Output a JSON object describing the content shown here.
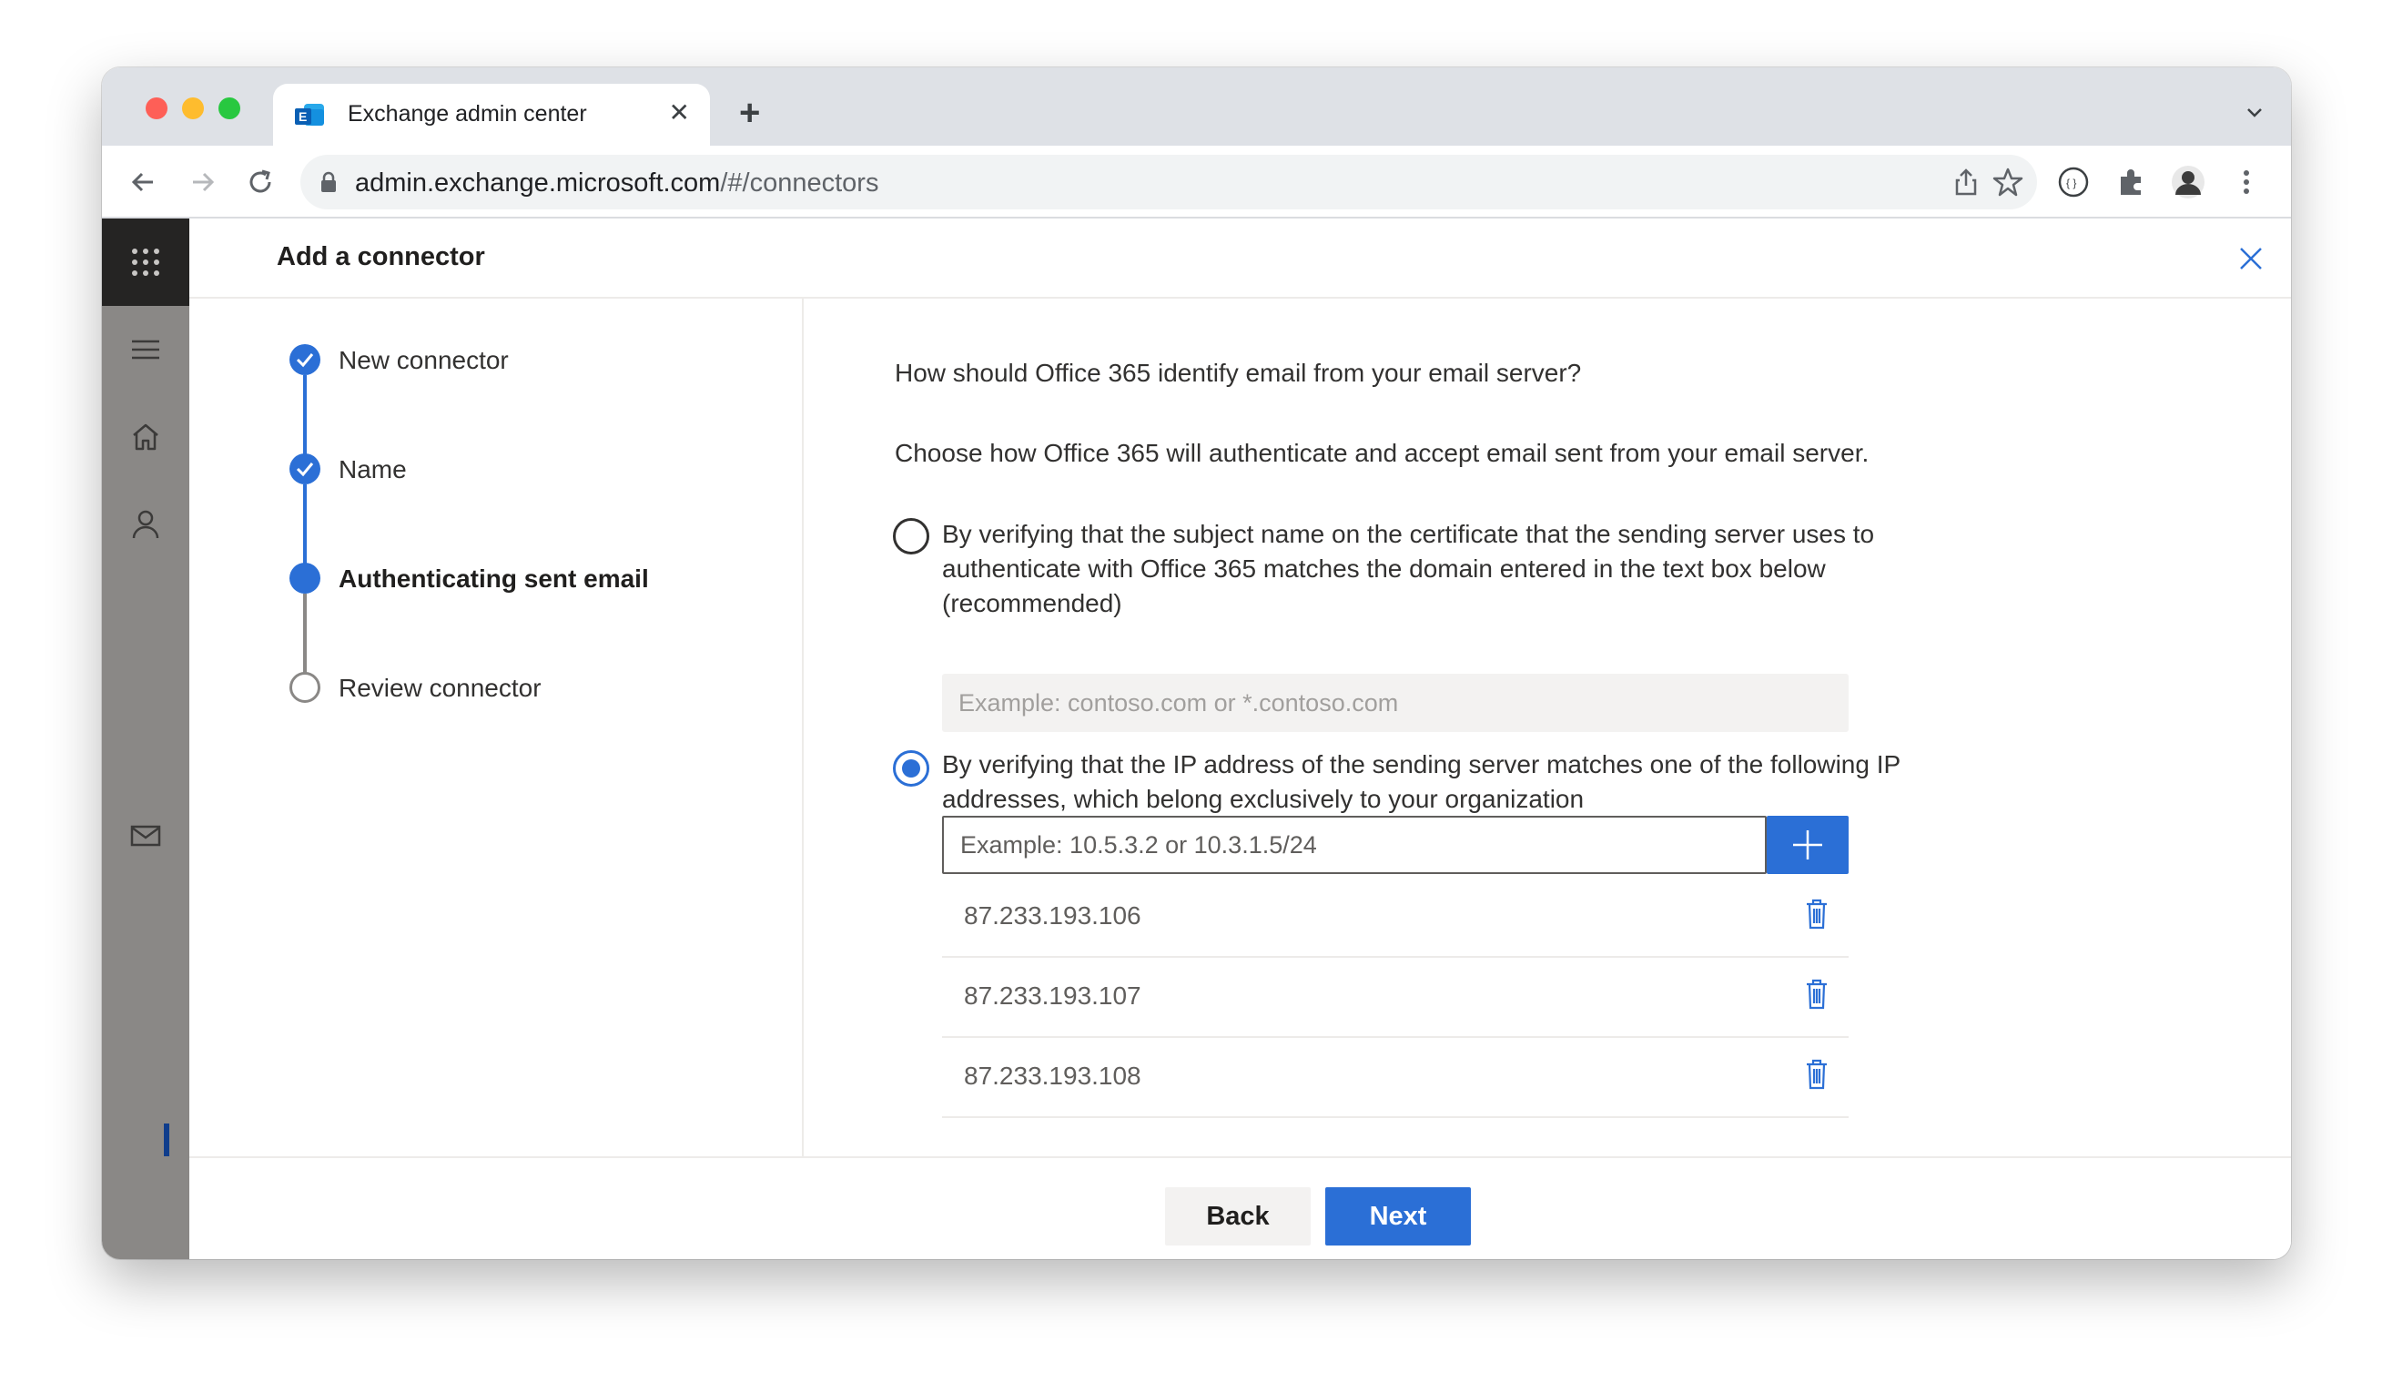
{
  "browser": {
    "tab_title": "Exchange admin center",
    "url_host": "admin.exchange.microsoft.com",
    "url_path": "/#/connectors"
  },
  "panel": {
    "title": "Add a connector",
    "steps": [
      {
        "label": "New connector",
        "state": "completed"
      },
      {
        "label": "Name",
        "state": "completed"
      },
      {
        "label": "Authenticating sent email",
        "state": "current"
      },
      {
        "label": "Review connector",
        "state": "pending"
      }
    ],
    "question": "How should Office 365 identify email from your email server?",
    "description": "Choose how Office 365 will authenticate and accept email sent from your email server.",
    "option_cert": {
      "label": "By verifying that the subject name on the certificate that the sending server uses to authenticate with Office 365 matches the domain entered in the text box below (recommended)",
      "selected": false,
      "placeholder": "Example: contoso.com or *.contoso.com"
    },
    "option_ip": {
      "label": "By verifying that the IP address of the sending server matches one of the following IP addresses, which belong exclusively to your organization",
      "selected": true,
      "placeholder": "Example: 10.5.3.2 or 10.3.1.5/24",
      "addresses": [
        "87.233.193.106",
        "87.233.193.107",
        "87.233.193.108"
      ]
    },
    "buttons": {
      "back": "Back",
      "next": "Next"
    }
  },
  "colors": {
    "accent": "#2b6fd6",
    "rail_dark": "#252423",
    "rail": "#8a8886"
  },
  "icons": [
    "waffle-icon",
    "hamburger-icon",
    "home-icon",
    "person-icon",
    "mail-icon",
    "close-icon",
    "add-icon",
    "trash-icon",
    "checkmark-icon"
  ]
}
